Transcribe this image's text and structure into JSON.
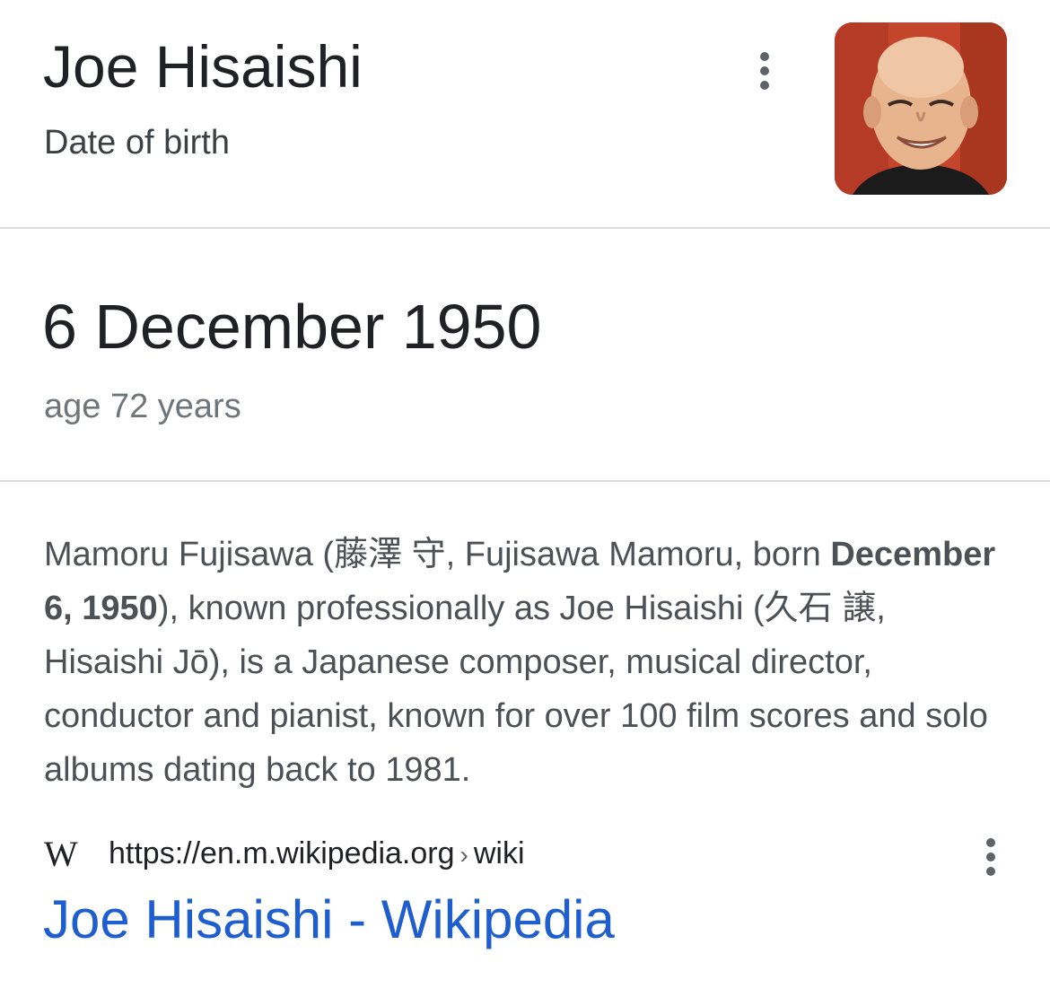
{
  "header": {
    "title": "Joe Hisaishi",
    "subtitle": "Date of birth"
  },
  "answer": {
    "date": "6 December 1950",
    "age": "age 72 years"
  },
  "description": {
    "part1": "Mamoru Fujisawa (藤澤 守, Fujisawa Mamoru, born ",
    "bold": "December 6, 1950",
    "part2": "), known professionally as Joe Hisaishi (久石 譲, Hisaishi Jō), is a Japanese composer, musical director, conductor and pianist, known for over 100 film scores and solo albums dating back to 1981."
  },
  "source": {
    "logo_text": "W",
    "url": "https://en.m.wikipedia.org",
    "separator": "›",
    "path": "wiki",
    "link_title": "Joe Hisaishi - Wikipedia"
  },
  "colors": {
    "link": "#1f5ecf",
    "divider": "#dadce0",
    "portrait_background": "#c8472e"
  },
  "icons": {
    "more_options": "kebab-vertical-icon",
    "source_logo": "wikipedia-logo-icon"
  }
}
